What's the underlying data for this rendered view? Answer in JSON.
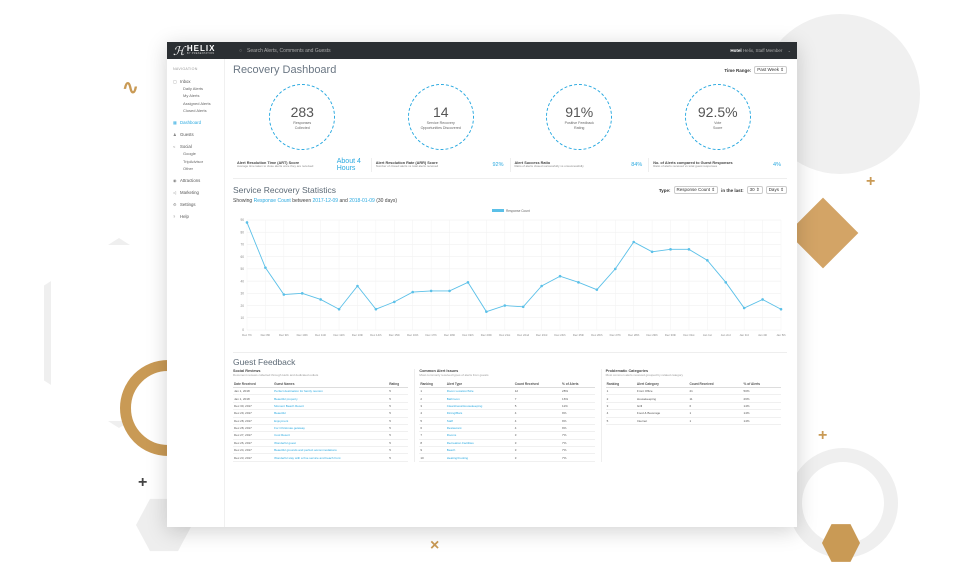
{
  "app": {
    "logo_name": "HELIX",
    "logo_sub": "BY PRESENTATION",
    "search_placeholder": "Search Alerts, Comments and Guests",
    "user_hotel": "Hotel",
    "user_role": "Helix, Staff Member"
  },
  "sidebar": {
    "title": "NAVIGATION",
    "inbox": "Inbox",
    "inbox_items": [
      "Daily Alerts",
      "My Alerts",
      "Assigned Alerts",
      "Closed Alerts"
    ],
    "dashboard": "Dashboard",
    "guests": "Guests",
    "social": "Social",
    "social_items": [
      "Google",
      "TripAdvisor",
      "Other"
    ],
    "attractions": "Attractions",
    "marketing": "Marketing",
    "settings": "Settings",
    "help": "Help"
  },
  "dashboard": {
    "title": "Recovery Dashboard",
    "time_range_label": "Time Range:",
    "time_range_value": "Past Week"
  },
  "stats": [
    {
      "value": "283",
      "label1": "Responses",
      "label2": "Collected"
    },
    {
      "value": "14",
      "label1": "Service Recovery",
      "label2": "Opportunities Discovered"
    },
    {
      "value": "91%",
      "label1": "Positive Feedback",
      "label2": "Rating"
    },
    {
      "value": "92.5%",
      "label1": "Vote",
      "label2": "Score"
    }
  ],
  "kpis": [
    {
      "title": "Alert Resolution Time (ART) Score",
      "desc": "Average time taken to close alerts once they are received",
      "value": "About 4 Hours"
    },
    {
      "title": "Alert Resolution Rate (ARR) Score",
      "desc": "Number of closed alerts vs total alerts received",
      "value": "92%"
    },
    {
      "title": "Alert Success Ratio",
      "desc": "Ratio of alerts closed successfully vs unsuccessfully",
      "value": "84%"
    },
    {
      "title": "No. of Alerts compared to Guest Responses",
      "desc": "Ratio of alerts received vs total guest responses",
      "value": "4%"
    }
  ],
  "srs": {
    "title": "Service Recovery Statistics",
    "type_label": "Type:",
    "type_value": "Response Count",
    "in_last_label": "in the last:",
    "in_last_value": "30",
    "unit_value": "Days",
    "showing_prefix": "Showing",
    "showing_metric": "Response Count",
    "showing_between": "between",
    "date_from": "2017-12-09",
    "showing_and": "and",
    "date_to": "2018-01-09",
    "showing_suffix": "(30 days)"
  },
  "chart_data": {
    "type": "line",
    "title": "",
    "xlabel": "",
    "ylabel": "",
    "ylim": [
      0,
      90
    ],
    "yticks": [
      0,
      10,
      20,
      30,
      40,
      50,
      60,
      70,
      80,
      90
    ],
    "grid": true,
    "legend_position": "top",
    "series": [
      {
        "name": "Response Count",
        "color": "#5bc0e8",
        "values": [
          88,
          51,
          29,
          30,
          25,
          17,
          36,
          17,
          23,
          31,
          32,
          32,
          39,
          15,
          20,
          19,
          36,
          44,
          39,
          33,
          50,
          72,
          64,
          66,
          66,
          57,
          39,
          18,
          25,
          17
        ]
      }
    ],
    "x": [
      "Dec 7th",
      "Dec 8th",
      "Dec 9th",
      "Dec 10th",
      "Dec 11th",
      "Dec 12th",
      "Dec 13th",
      "Dec 14th",
      "Dec 15th",
      "Dec 16th",
      "Dec 17th",
      "Dec 18th",
      "Dec 19th",
      "Dec 20th",
      "Dec 21st",
      "Dec 22nd",
      "Dec 23rd",
      "Dec 24th",
      "Dec 25th",
      "Dec 26th",
      "Dec 27th",
      "Dec 28th",
      "Dec 29th",
      "Dec 30th",
      "Dec 31st",
      "Jan 1st",
      "Jan 2nd",
      "Jan 3rd",
      "Jan 4th",
      "Jan 5th"
    ]
  },
  "feedback": {
    "title": "Guest Feedback",
    "reviews_title": "Social Reviews",
    "reviews_desc": "Document reviews collected through Helix and dedicated outlets",
    "reviews_headers": [
      "Date Received",
      "Guest Names",
      "Rating"
    ],
    "reviews_rows": [
      [
        "Jan 1, 2018",
        "Perfect destination for family reunion",
        "5"
      ],
      [
        "Jan 1, 2018",
        "Beautiful property",
        "5"
      ],
      [
        "Dec 30, 2017",
        "Moment Beach Resort",
        "5"
      ],
      [
        "Dec 29, 2017",
        "Beautiful",
        "5"
      ],
      [
        "Dec 28, 2017",
        "Enjoyment",
        "5"
      ],
      [
        "Dec 28, 2017",
        "For Christmas getaway",
        "5"
      ],
      [
        "Dec 27, 2017",
        "Cool Resort",
        "5"
      ],
      [
        "Dec 26, 2017",
        "Wonderful guest",
        "5"
      ],
      [
        "Dec 24, 2017",
        "Beautiful grounds and perfect accommodations",
        "5"
      ],
      [
        "Dec 23, 2017",
        "Wonderful stay with a fine service and beach front",
        "5"
      ]
    ],
    "issues_title": "Common Alert Issues",
    "issues_desc": "Most commonly received types of alerts from guests",
    "issues_headers": [
      "Ranking",
      "Alert Type",
      "Count Received",
      "% of Alerts"
    ],
    "issues_rows": [
      [
        "1",
        "Room Location/Size",
        "12",
        "28%"
      ],
      [
        "2",
        "Bathroom",
        "7",
        "16%"
      ],
      [
        "3",
        "Cleanliness/Housekeeping",
        "5",
        "11%"
      ],
      [
        "4",
        "Dining/Bars",
        "4",
        "9%"
      ],
      [
        "5",
        "Staff",
        "4",
        "9%"
      ],
      [
        "6",
        "Restaurant",
        "4",
        "9%"
      ],
      [
        "7",
        "Rooms",
        "3",
        "7%"
      ],
      [
        "8",
        "Recreation Facilities",
        "3",
        "7%"
      ],
      [
        "9",
        "Beach",
        "3",
        "7%"
      ],
      [
        "10",
        "Heating/Cooling",
        "3",
        "7%"
      ]
    ],
    "cats_title": "Problematic Categories",
    "cats_desc": "Most common alerts received grouped by related category",
    "cats_headers": [
      "Ranking",
      "Alert Category",
      "Count Received",
      "% of Alerts"
    ],
    "cats_rows": [
      [
        "1",
        "Front Office",
        "21",
        "50%"
      ],
      [
        "2",
        "Housekeeping",
        "11",
        "26%"
      ],
      [
        "3",
        "Grill",
        "6",
        "14%"
      ],
      [
        "4",
        "Food & Beverage",
        "1",
        "14%"
      ],
      [
        "5",
        "Internet",
        "1",
        "14%"
      ]
    ]
  },
  "colors": {
    "accent": "#2aa9e0",
    "topbar": "#2b2f33",
    "gold": "#c99a55"
  }
}
